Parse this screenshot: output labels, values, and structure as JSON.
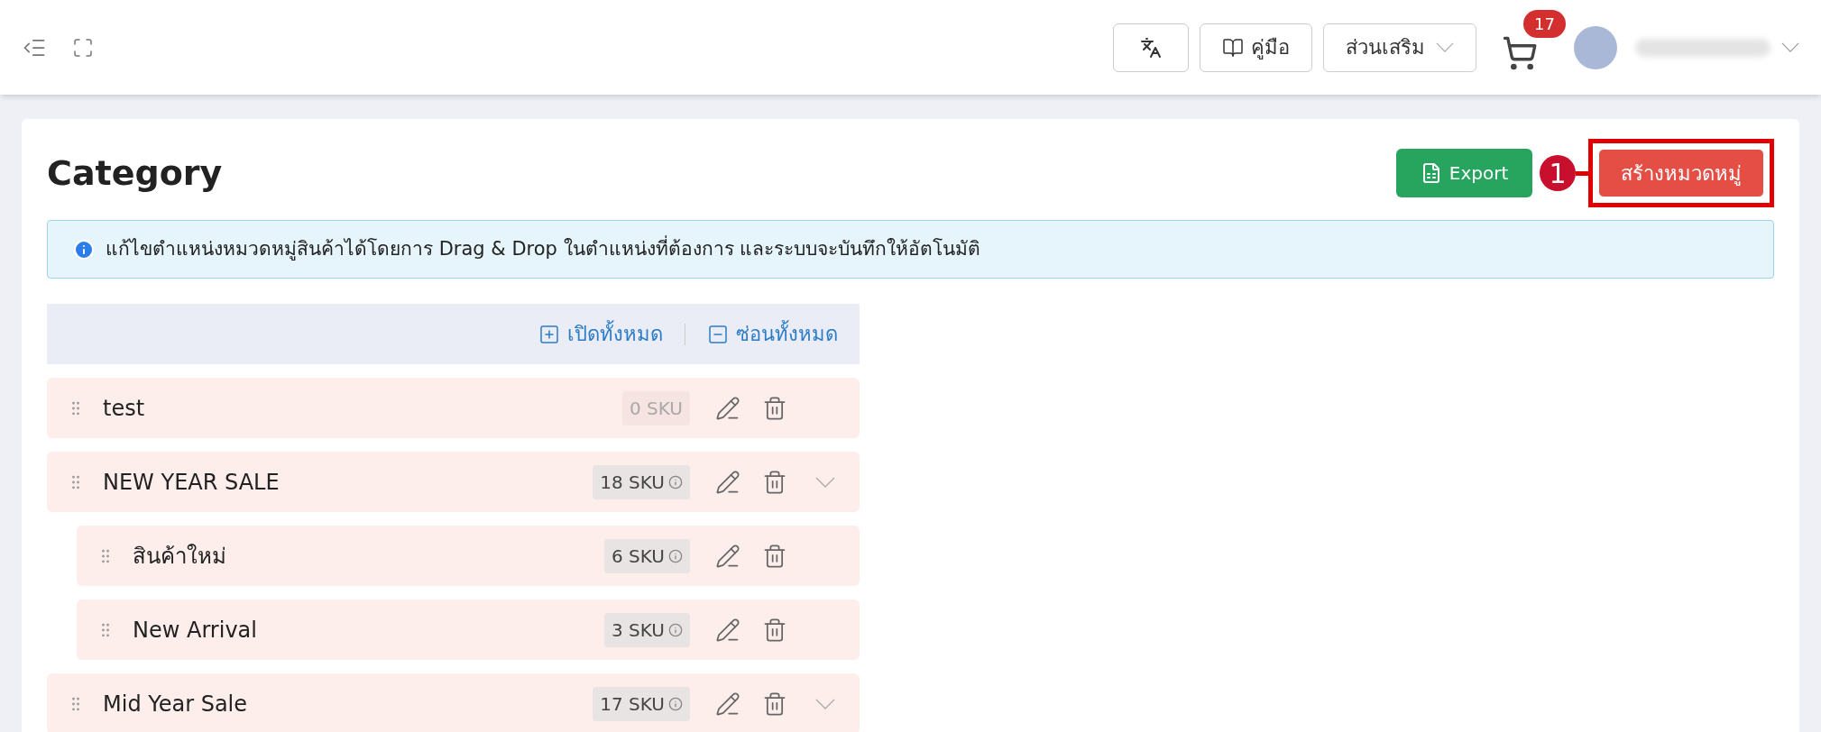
{
  "header": {
    "manual_button": "คู่มือ",
    "addons_dropdown": "ส่วนเสริม",
    "cart_count": "17"
  },
  "page": {
    "title": "Category",
    "export_button": "Export",
    "create_button": "สร้างหมวดหมู่",
    "callout_number": "1"
  },
  "info_banner": "แก้ไขตำแหน่งหมวดหมู่สินค้าได้โดยการ Drag & Drop ในตำแหน่งที่ต้องการ และระบบจะบันทึกให้อัตโนมัติ",
  "toolbar": {
    "expand_all": "เปิดทั้งหมด",
    "collapse_all": "ซ่อนทั้งหมด"
  },
  "categories": [
    {
      "name": "test",
      "sku": "0 SKU",
      "disabled": true,
      "has_toggle": false
    },
    {
      "name": "NEW YEAR SALE",
      "sku": "18 SKU",
      "disabled": false,
      "has_toggle": true,
      "children": [
        {
          "name": "สินค้าใหม่",
          "sku": "6 SKU",
          "disabled": false,
          "has_toggle": false
        },
        {
          "name": "New Arrival",
          "sku": "3 SKU",
          "disabled": false,
          "has_toggle": false
        }
      ]
    },
    {
      "name": "Mid Year Sale",
      "sku": "17 SKU",
      "disabled": false,
      "has_toggle": true
    }
  ]
}
